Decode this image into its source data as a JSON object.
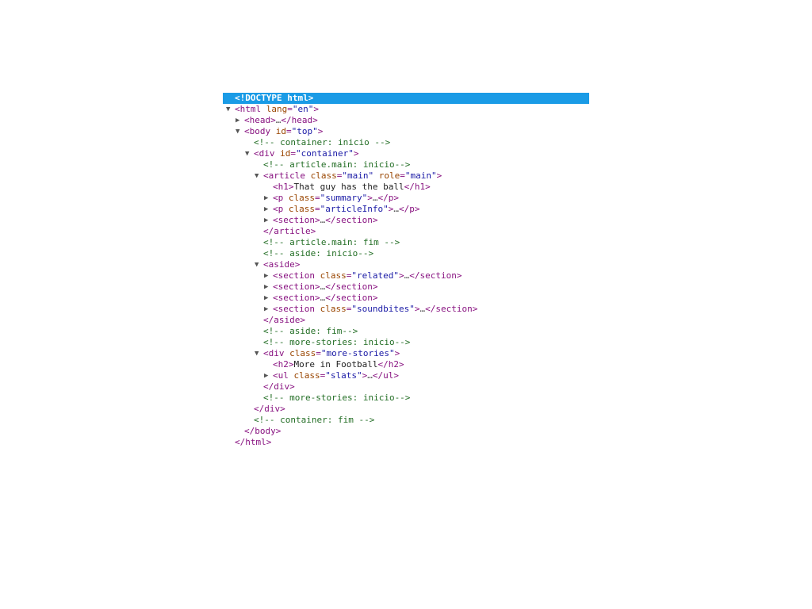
{
  "colors": {
    "selection": "#1a9be6",
    "tag": "#881280",
    "attribute_name": "#994500",
    "attribute_value": "#1a1aa6",
    "comment": "#236e25",
    "text": "#222222"
  },
  "icons": {
    "expanded": "triangle-down-icon",
    "collapsed": "triangle-right-icon"
  },
  "tree": [
    {
      "depth": 0,
      "toggle": "none",
      "selected": true,
      "parts": [
        [
          "tag",
          "<!DOCTYPE html>"
        ]
      ]
    },
    {
      "depth": 0,
      "toggle": "expanded",
      "parts": [
        [
          "tag",
          "<html "
        ],
        [
          "attr",
          "lang"
        ],
        [
          "tag",
          "="
        ],
        [
          "val",
          "\"en\""
        ],
        [
          "tag",
          ">"
        ]
      ]
    },
    {
      "depth": 1,
      "toggle": "collapsed",
      "parts": [
        [
          "tag",
          "<head>"
        ],
        [
          "ell",
          "…"
        ],
        [
          "tag",
          "</head>"
        ]
      ]
    },
    {
      "depth": 1,
      "toggle": "expanded",
      "parts": [
        [
          "tag",
          "<body "
        ],
        [
          "attr",
          "id"
        ],
        [
          "tag",
          "="
        ],
        [
          "val",
          "\"top\""
        ],
        [
          "tag",
          ">"
        ]
      ]
    },
    {
      "depth": 2,
      "toggle": "none",
      "parts": [
        [
          "comment",
          "<!-- container: inicio -->"
        ]
      ]
    },
    {
      "depth": 2,
      "toggle": "expanded",
      "parts": [
        [
          "tag",
          "<div "
        ],
        [
          "attr",
          "id"
        ],
        [
          "tag",
          "="
        ],
        [
          "val",
          "\"container\""
        ],
        [
          "tag",
          ">"
        ]
      ]
    },
    {
      "depth": 3,
      "toggle": "none",
      "parts": [
        [
          "comment",
          "<!-- article.main: inicio-->"
        ]
      ]
    },
    {
      "depth": 3,
      "toggle": "expanded",
      "parts": [
        [
          "tag",
          "<article "
        ],
        [
          "attr",
          "class"
        ],
        [
          "tag",
          "="
        ],
        [
          "val",
          "\"main\""
        ],
        [
          "tag",
          " "
        ],
        [
          "attr",
          "role"
        ],
        [
          "tag",
          "="
        ],
        [
          "val",
          "\"main\""
        ],
        [
          "tag",
          ">"
        ]
      ]
    },
    {
      "depth": 4,
      "toggle": "none",
      "parts": [
        [
          "tag",
          "<h1>"
        ],
        [
          "txt",
          "That guy has the ball"
        ],
        [
          "tag",
          "</h1>"
        ]
      ]
    },
    {
      "depth": 4,
      "toggle": "collapsed",
      "parts": [
        [
          "tag",
          "<p "
        ],
        [
          "attr",
          "class"
        ],
        [
          "tag",
          "="
        ],
        [
          "val",
          "\"summary\""
        ],
        [
          "tag",
          ">"
        ],
        [
          "ell",
          "…"
        ],
        [
          "tag",
          "</p>"
        ]
      ]
    },
    {
      "depth": 4,
      "toggle": "collapsed",
      "parts": [
        [
          "tag",
          "<p "
        ],
        [
          "attr",
          "class"
        ],
        [
          "tag",
          "="
        ],
        [
          "val",
          "\"articleInfo\""
        ],
        [
          "tag",
          ">"
        ],
        [
          "ell",
          "…"
        ],
        [
          "tag",
          "</p>"
        ]
      ]
    },
    {
      "depth": 4,
      "toggle": "collapsed",
      "parts": [
        [
          "tag",
          "<section>"
        ],
        [
          "ell",
          "…"
        ],
        [
          "tag",
          "</section>"
        ]
      ]
    },
    {
      "depth": 3,
      "toggle": "none",
      "parts": [
        [
          "tag",
          "</article>"
        ]
      ]
    },
    {
      "depth": 3,
      "toggle": "none",
      "parts": [
        [
          "comment",
          "<!-- article.main: fim -->"
        ]
      ]
    },
    {
      "depth": 3,
      "toggle": "none",
      "parts": [
        [
          "comment",
          "<!-- aside: inicio-->"
        ]
      ]
    },
    {
      "depth": 3,
      "toggle": "expanded",
      "parts": [
        [
          "tag",
          "<aside>"
        ]
      ]
    },
    {
      "depth": 4,
      "toggle": "collapsed",
      "parts": [
        [
          "tag",
          "<section "
        ],
        [
          "attr",
          "class"
        ],
        [
          "tag",
          "="
        ],
        [
          "val",
          "\"related\""
        ],
        [
          "tag",
          ">"
        ],
        [
          "ell",
          "…"
        ],
        [
          "tag",
          "</section>"
        ]
      ]
    },
    {
      "depth": 4,
      "toggle": "collapsed",
      "parts": [
        [
          "tag",
          "<section>"
        ],
        [
          "ell",
          "…"
        ],
        [
          "tag",
          "</section>"
        ]
      ]
    },
    {
      "depth": 4,
      "toggle": "collapsed",
      "parts": [
        [
          "tag",
          "<section>"
        ],
        [
          "ell",
          "…"
        ],
        [
          "tag",
          "</section>"
        ]
      ]
    },
    {
      "depth": 4,
      "toggle": "collapsed",
      "parts": [
        [
          "tag",
          "<section "
        ],
        [
          "attr",
          "class"
        ],
        [
          "tag",
          "="
        ],
        [
          "val",
          "\"soundbites\""
        ],
        [
          "tag",
          ">"
        ],
        [
          "ell",
          "…"
        ],
        [
          "tag",
          "</section>"
        ]
      ]
    },
    {
      "depth": 3,
      "toggle": "none",
      "parts": [
        [
          "tag",
          "</aside>"
        ]
      ]
    },
    {
      "depth": 3,
      "toggle": "none",
      "parts": [
        [
          "comment",
          "<!-- aside: fim-->"
        ]
      ]
    },
    {
      "depth": 3,
      "toggle": "none",
      "parts": [
        [
          "comment",
          "<!-- more-stories: inicio-->"
        ]
      ]
    },
    {
      "depth": 3,
      "toggle": "expanded",
      "parts": [
        [
          "tag",
          "<div "
        ],
        [
          "attr",
          "class"
        ],
        [
          "tag",
          "="
        ],
        [
          "val",
          "\"more-stories\""
        ],
        [
          "tag",
          ">"
        ]
      ]
    },
    {
      "depth": 4,
      "toggle": "none",
      "parts": [
        [
          "tag",
          "<h2>"
        ],
        [
          "txt",
          "More in Football"
        ],
        [
          "tag",
          "</h2>"
        ]
      ]
    },
    {
      "depth": 4,
      "toggle": "collapsed",
      "parts": [
        [
          "tag",
          "<ul "
        ],
        [
          "attr",
          "class"
        ],
        [
          "tag",
          "="
        ],
        [
          "val",
          "\"slats\""
        ],
        [
          "tag",
          ">"
        ],
        [
          "ell",
          "…"
        ],
        [
          "tag",
          "</ul>"
        ]
      ]
    },
    {
      "depth": 3,
      "toggle": "none",
      "parts": [
        [
          "tag",
          "</div>"
        ]
      ]
    },
    {
      "depth": 3,
      "toggle": "none",
      "parts": [
        [
          "comment",
          "<!-- more-stories: inicio-->"
        ]
      ]
    },
    {
      "depth": 2,
      "toggle": "none",
      "parts": [
        [
          "tag",
          "</div>"
        ]
      ]
    },
    {
      "depth": 2,
      "toggle": "none",
      "parts": [
        [
          "comment",
          "<!-- container: fim -->"
        ]
      ]
    },
    {
      "depth": 1,
      "toggle": "none",
      "parts": [
        [
          "tag",
          "</body>"
        ]
      ]
    },
    {
      "depth": 0,
      "toggle": "none",
      "parts": [
        [
          "tag",
          "</html>"
        ]
      ]
    }
  ]
}
